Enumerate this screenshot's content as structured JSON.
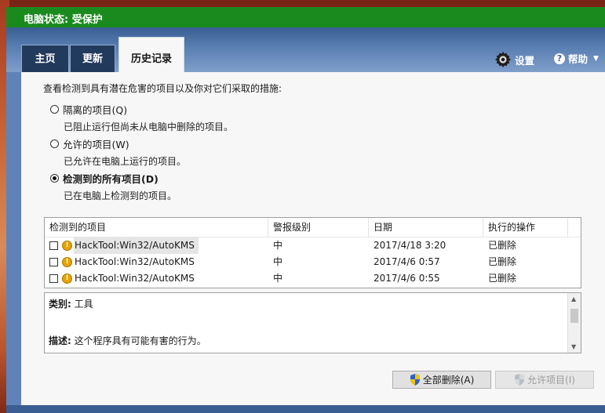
{
  "window": {
    "title": "电脑状态: 受保护",
    "title_color": "#1a8a1f"
  },
  "tabs": [
    {
      "label": "主页"
    },
    {
      "label": "更新"
    },
    {
      "label": "历史记录",
      "active": true
    }
  ],
  "header_links": {
    "settings": {
      "label": "设置",
      "icon": "gear-icon"
    },
    "help": {
      "label": "帮助",
      "icon": "help-icon"
    }
  },
  "intro": "查看检测到具有潜在危害的项目以及你对它们采取的措施:",
  "options": [
    {
      "label": "隔离的项目(Q)",
      "desc": "已阻止运行但尚未从电脑中删除的项目。",
      "selected": false
    },
    {
      "label": "允许的项目(W)",
      "desc": "已允许在电脑上运行的项目。",
      "selected": false
    },
    {
      "label": "检测到的所有项目(D)",
      "desc": "已在电脑上检测到的项目。",
      "selected": true
    }
  ],
  "table": {
    "columns": [
      "检测到的项目",
      "警报级别",
      "日期",
      "执行的操作"
    ],
    "rows": [
      {
        "item": "HackTool:Win32/AutoKMS",
        "level": "中",
        "date": "2017/4/18 3:20",
        "action": "已删除",
        "selected": true
      },
      {
        "item": "HackTool:Win32/AutoKMS",
        "level": "中",
        "date": "2017/4/6 0:57",
        "action": "已删除"
      },
      {
        "item": "HackTool:Win32/AutoKMS",
        "level": "中",
        "date": "2017/4/6 0:55",
        "action": "已删除"
      }
    ]
  },
  "details": {
    "category_label": "类别:",
    "category_value": "工具",
    "description_label": "描述:",
    "description_value": "这个程序具有可能有害的行为。"
  },
  "buttons": {
    "remove_all": {
      "label": "全部删除(A)",
      "enabled": true
    },
    "allow": {
      "label": "允许项目(I)",
      "enabled": false
    }
  }
}
